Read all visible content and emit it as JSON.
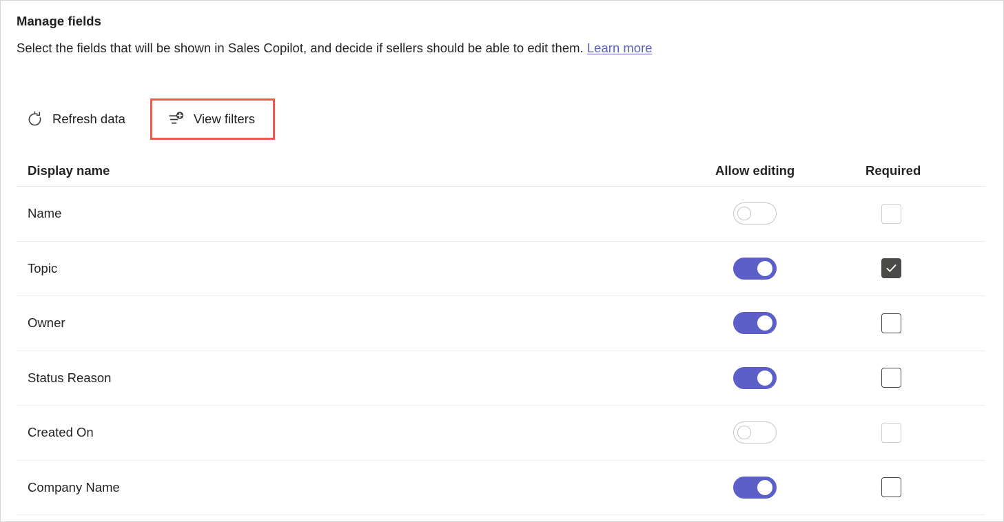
{
  "header": {
    "title": "Manage fields",
    "subtitle_text": "Select the fields that will be shown in Sales Copilot, and decide if sellers should be able to edit them.",
    "learn_more_label": "Learn more"
  },
  "commandbar": {
    "refresh_label": "Refresh data",
    "refresh_icon": "refresh-icon",
    "view_filters_label": "View filters",
    "view_filters_icon": "filter-add-icon",
    "highlight_color": "#ed5a4d"
  },
  "table": {
    "columns": [
      "Display name",
      "Allow editing",
      "Required"
    ],
    "rows": [
      {
        "name": "Name",
        "allow_editing": false,
        "editing_disabled": true,
        "required": false,
        "required_disabled": true
      },
      {
        "name": "Topic",
        "allow_editing": true,
        "editing_disabled": false,
        "required": true,
        "required_disabled": false
      },
      {
        "name": "Owner",
        "allow_editing": true,
        "editing_disabled": false,
        "required": false,
        "required_disabled": false
      },
      {
        "name": "Status Reason",
        "allow_editing": true,
        "editing_disabled": false,
        "required": false,
        "required_disabled": false
      },
      {
        "name": "Created On",
        "allow_editing": false,
        "editing_disabled": true,
        "required": false,
        "required_disabled": true
      },
      {
        "name": "Company Name",
        "allow_editing": true,
        "editing_disabled": false,
        "required": false,
        "required_disabled": false
      }
    ]
  },
  "colors": {
    "accent_purple": "#5b5fc7",
    "link_purple": "#5b5fc7",
    "checkbox_dark": "#4a4a48",
    "highlight_red": "#ed5a4d",
    "text_primary": "#242424"
  }
}
